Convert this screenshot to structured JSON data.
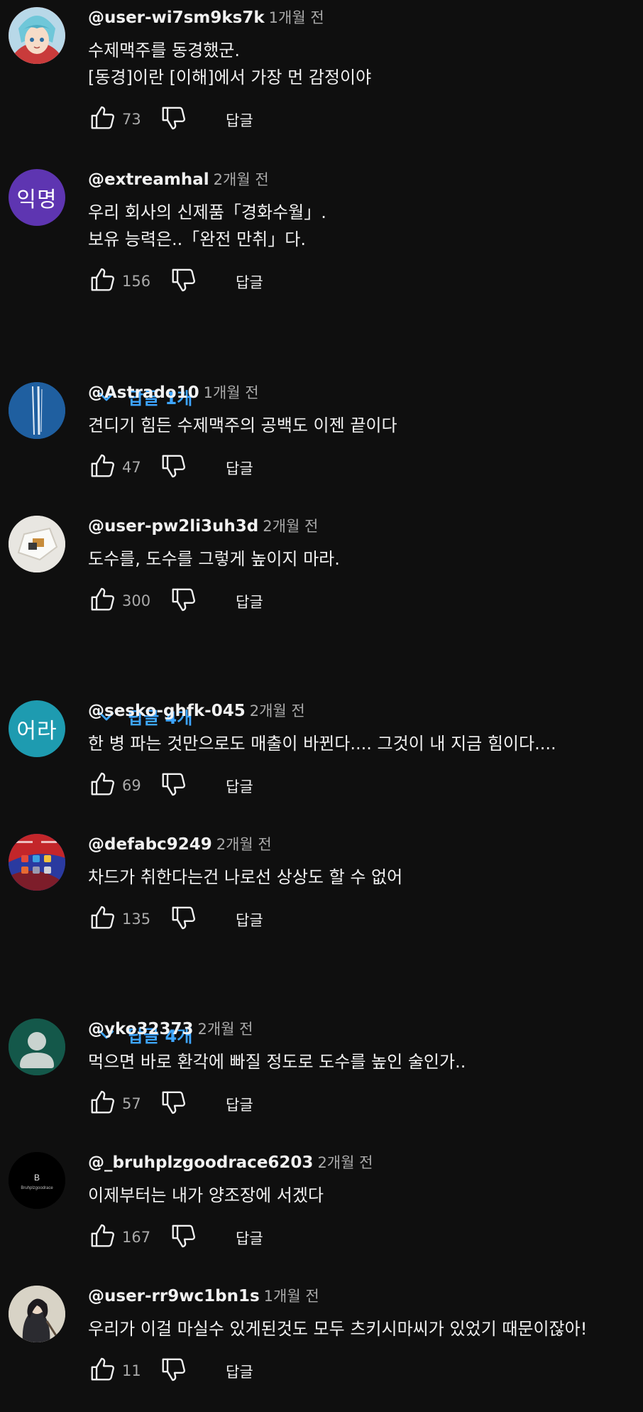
{
  "reply_label": "답글",
  "comments": [
    {
      "author": "@user-wi7sm9ks7k",
      "time": "1개월 전",
      "lines": [
        "수제맥주를 동경했군.",
        "[동경]이란 [이해]에서 가장 먼 감정이야"
      ],
      "likes": "73",
      "avatar": {
        "type": "anime",
        "bg": "#c93b3b"
      }
    },
    {
      "author": "@extreamhal",
      "time": "2개월 전",
      "lines": [
        "우리 회사의 신제품「경화수월」.",
        "보유 능력은..「완전 만취」다."
      ],
      "likes": "156",
      "avatar": {
        "type": "text",
        "text": "익명",
        "bg": "#5e35b1"
      },
      "replies": "답글 1개"
    },
    {
      "author": "@Astrado10",
      "time": "1개월 전",
      "lines": [
        "견디기 힘든 수제맥주의 공백도 이젠 끝이다"
      ],
      "likes": "47",
      "avatar": {
        "type": "blue",
        "bg": "#1f5fa0"
      }
    },
    {
      "author": "@user-pw2li3uh3d",
      "time": "2개월 전",
      "lines": [
        "도수를, 도수를 그렇게 높이지 마라."
      ],
      "likes": "300",
      "avatar": {
        "type": "hexagon",
        "bg": "#e8e6e1"
      },
      "replies": "답글 4개"
    },
    {
      "author": "@sesko-ghfk-045",
      "time": "2개월 전",
      "lines": [
        "한 병 파는 것만으로도 매출이 바뀐다.... 그것이 내 지금 힘이다...."
      ],
      "likes": "69",
      "avatar": {
        "type": "text",
        "text": "어라",
        "bg": "#1e9bb0"
      }
    },
    {
      "author": "@defabc9249",
      "time": "2개월 전",
      "lines": [
        "차드가 취한다는건 나로선 상상도 할 수 없어"
      ],
      "likes": "135",
      "avatar": {
        "type": "phone",
        "bg": "#2a3aa0"
      },
      "replies": "답글 4개"
    },
    {
      "author": "@yko32373",
      "time": "2개월 전",
      "lines": [
        "먹으면 바로 환각에 빠질 정도로 도수를 높인 술인가.."
      ],
      "likes": "57",
      "avatar": {
        "type": "default",
        "bg": "#14584a"
      }
    },
    {
      "author": "@_bruhplzgoodrace6203",
      "time": "2개월 전",
      "lines": [
        "이제부터는 내가 양조장에 서겠다"
      ],
      "likes": "167",
      "avatar": {
        "type": "logo",
        "bg": "#000000",
        "letter": "B",
        "sub": "Bruhplzgoodrace"
      }
    },
    {
      "author": "@user-rr9wc1bn1s",
      "time": "1개월 전",
      "lines": [
        "우리가 이걸 마실수 있게된것도 모두 츠키시마씨가 있었기 때문이잖아!"
      ],
      "likes": "11",
      "avatar": {
        "type": "photo",
        "bg": "#d8d3c6"
      }
    }
  ]
}
